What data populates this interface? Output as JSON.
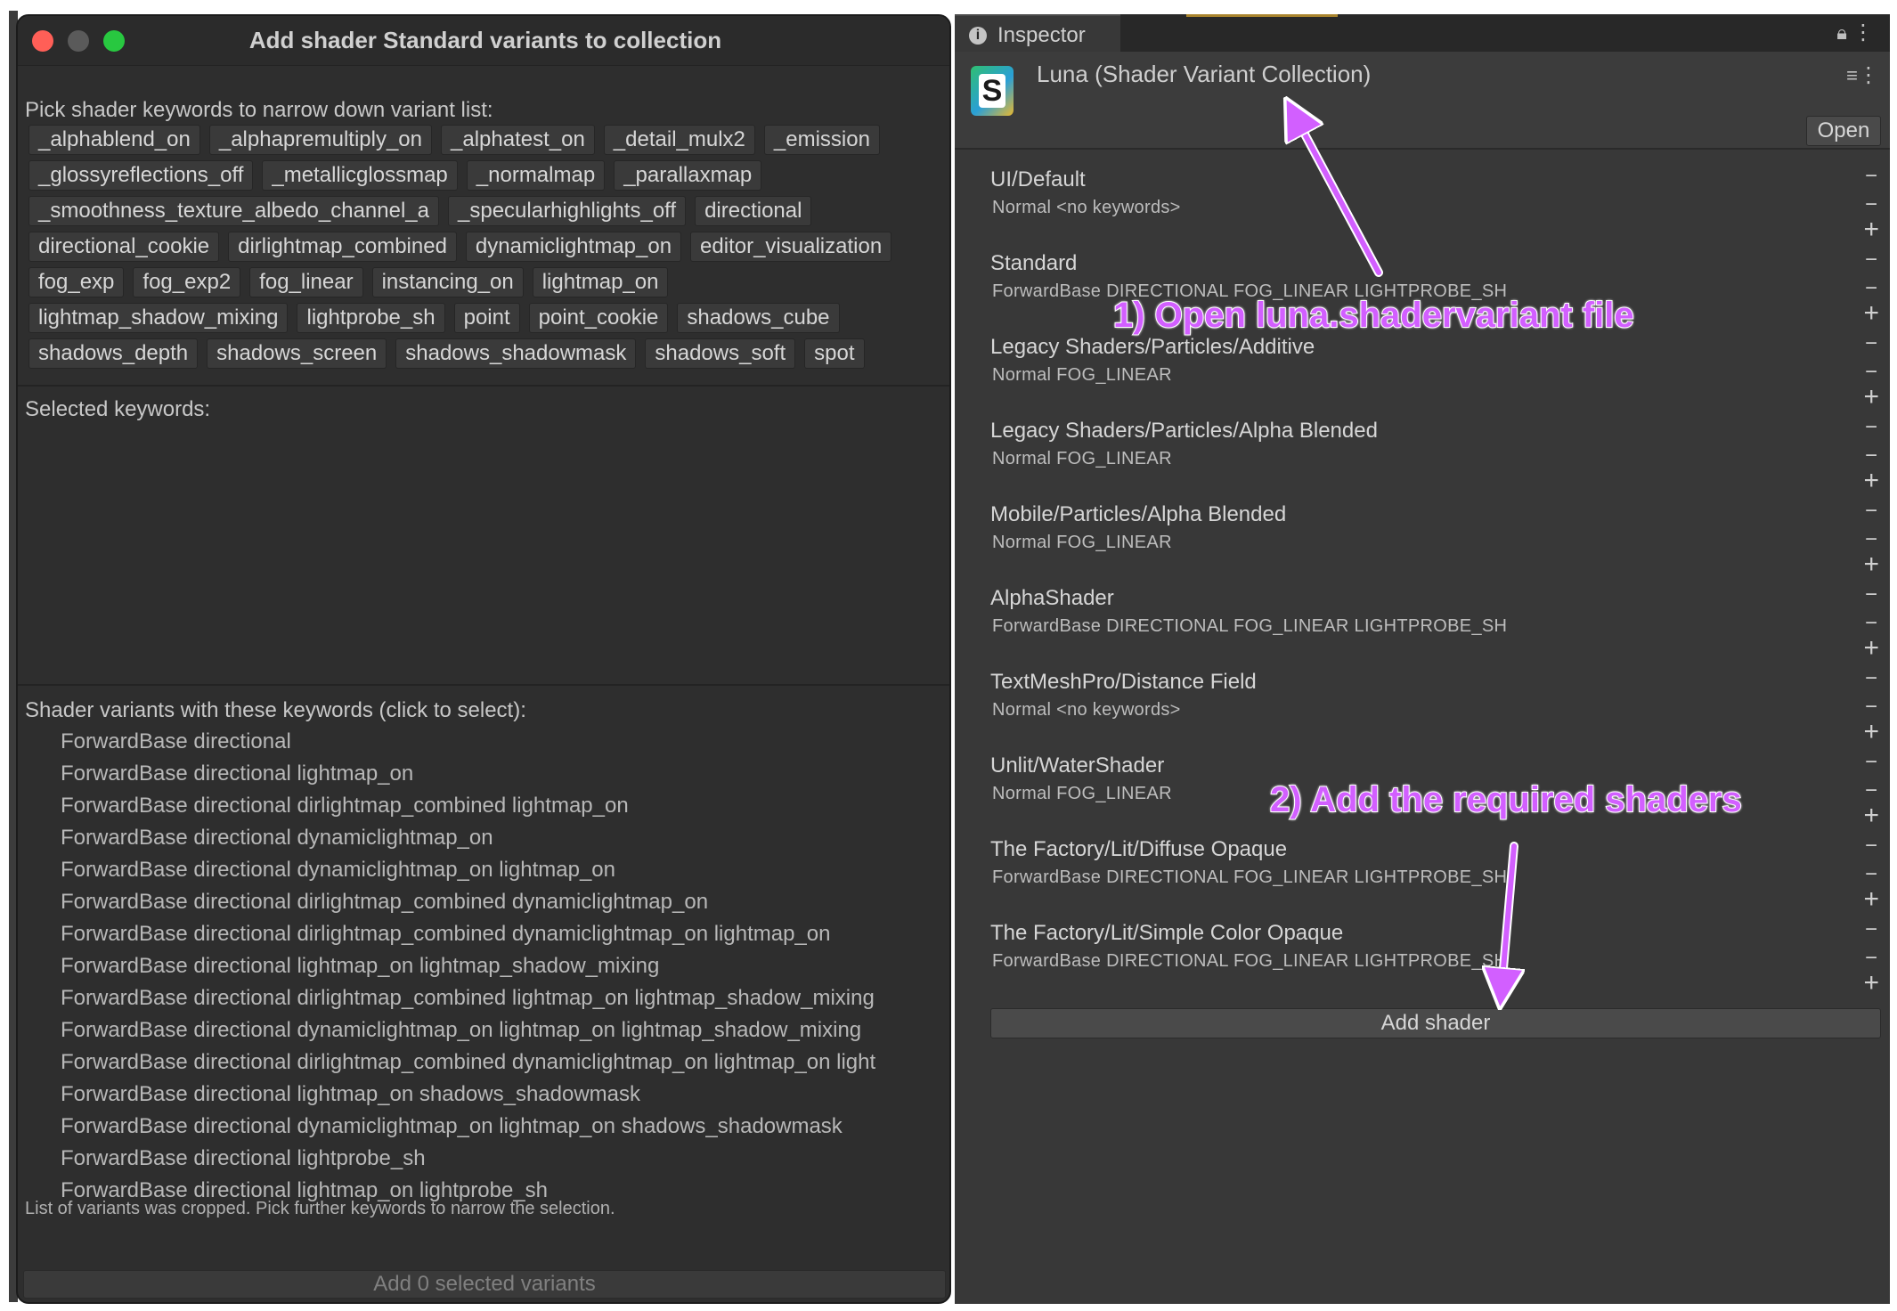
{
  "left_window": {
    "title": "Add shader Standard variants to collection",
    "pick_label": "Pick shader keywords to narrow down variant list:",
    "keyword_rows": [
      [
        "_alphablend_on",
        "_alphapremultiply_on",
        "_alphatest_on",
        "_detail_mulx2",
        "_emission"
      ],
      [
        "_glossyreflections_off",
        "_metallicglossmap",
        "_normalmap",
        "_parallaxmap"
      ],
      [
        "_smoothness_texture_albedo_channel_a",
        "_specularhighlights_off",
        "directional"
      ],
      [
        "directional_cookie",
        "dirlightmap_combined",
        "dynamiclightmap_on",
        "editor_visualization"
      ],
      [
        "fog_exp",
        "fog_exp2",
        "fog_linear",
        "instancing_on",
        "lightmap_on"
      ],
      [
        "lightmap_shadow_mixing",
        "lightprobe_sh",
        "point",
        "point_cookie",
        "shadows_cube"
      ],
      [
        "shadows_depth",
        "shadows_screen",
        "shadows_shadowmask",
        "shadows_soft",
        "spot"
      ]
    ],
    "selected_label": "Selected keywords:",
    "variants_label": "Shader variants with these keywords (click to select):",
    "variants": [
      "ForwardBase directional",
      "ForwardBase directional lightmap_on",
      "ForwardBase directional dirlightmap_combined lightmap_on",
      "ForwardBase directional dynamiclightmap_on",
      "ForwardBase directional dynamiclightmap_on lightmap_on",
      "ForwardBase directional dirlightmap_combined dynamiclightmap_on",
      "ForwardBase directional dirlightmap_combined dynamiclightmap_on lightmap_on",
      "ForwardBase directional lightmap_on lightmap_shadow_mixing",
      "ForwardBase directional dirlightmap_combined lightmap_on lightmap_shadow_mixing",
      "ForwardBase directional dynamiclightmap_on lightmap_on lightmap_shadow_mixing",
      "ForwardBase directional dirlightmap_combined dynamiclightmap_on lightmap_on light",
      "ForwardBase directional lightmap_on shadows_shadowmask",
      "ForwardBase directional dynamiclightmap_on lightmap_on shadows_shadowmask",
      "ForwardBase directional lightprobe_sh",
      "ForwardBase directional lightmap_on lightprobe_sh"
    ],
    "cropped_note": "List of variants was cropped. Pick further keywords to narrow the selection.",
    "add_button_label": "Add 0 selected variants"
  },
  "inspector": {
    "tab_label": "Inspector",
    "tab_icon": "info-icon",
    "asset_title": "Luna (Shader Variant Collection)",
    "asset_icon_letter": "S",
    "open_label": "Open",
    "shaders": [
      {
        "name": "UI/Default",
        "variant": "Normal <no keywords>"
      },
      {
        "name": "Standard",
        "variant": "ForwardBase DIRECTIONAL FOG_LINEAR LIGHTPROBE_SH"
      },
      {
        "name": "Legacy Shaders/Particles/Additive",
        "variant": "Normal FOG_LINEAR"
      },
      {
        "name": "Legacy Shaders/Particles/Alpha Blended",
        "variant": "Normal FOG_LINEAR"
      },
      {
        "name": "Mobile/Particles/Alpha Blended",
        "variant": "Normal FOG_LINEAR"
      },
      {
        "name": "AlphaShader",
        "variant": "ForwardBase DIRECTIONAL FOG_LINEAR LIGHTPROBE_SH"
      },
      {
        "name": "TextMeshPro/Distance Field",
        "variant": "Normal <no keywords>"
      },
      {
        "name": "Unlit/WaterShader",
        "variant": "Normal FOG_LINEAR"
      },
      {
        "name": "The Factory/Lit/Diffuse Opaque",
        "variant": "ForwardBase DIRECTIONAL FOG_LINEAR LIGHTPROBE_SH"
      },
      {
        "name": "The Factory/Lit/Simple Color Opaque",
        "variant": "ForwardBase DIRECTIONAL FOG_LINEAR LIGHTPROBE_SH"
      }
    ],
    "minus_glyph": "−",
    "plus_glyph": "+",
    "add_shader_label": "Add shader"
  },
  "annotations": {
    "step1": "1) Open luna.shadervariant file",
    "step2": "2) Add the required shaders",
    "color": "#d25fff"
  },
  "colors": {
    "close": "#ff5f57",
    "maximize": "#28c840",
    "panel_bg": "#2e2e2e",
    "inspector_bg": "#383838"
  }
}
